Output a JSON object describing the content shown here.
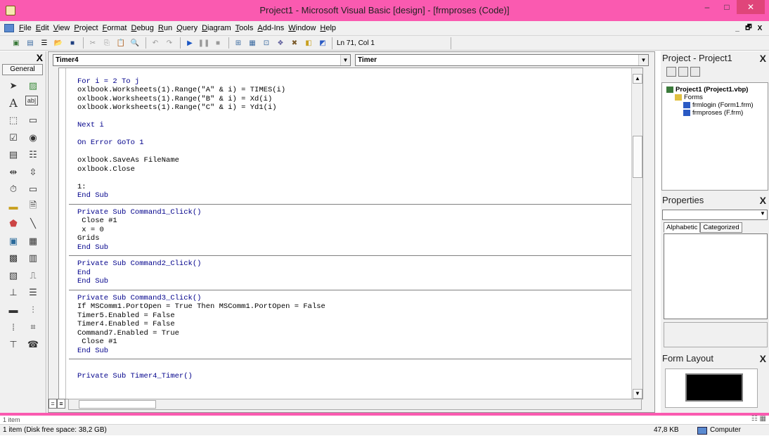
{
  "window": {
    "title": "Project1 - Microsoft Visual Basic [design] - [frmproses (Code)]",
    "minimize": "–",
    "maximize": "□",
    "close": "✕"
  },
  "menu": [
    "File",
    "Edit",
    "View",
    "Project",
    "Format",
    "Debug",
    "Run",
    "Query",
    "Diagram",
    "Tools",
    "Add-Ins",
    "Window",
    "Help"
  ],
  "mdi_controls": [
    "_",
    "🗗",
    "X"
  ],
  "toolbar": {
    "position": "Ln 71, Col 1"
  },
  "toolbox": {
    "close": "X",
    "tab": "General"
  },
  "code": {
    "object_combo": "Timer4",
    "proc_combo": "Timer",
    "lines": [
      {
        "t": "",
        "k": "gap"
      },
      {
        "t": "For i = 2 To j",
        "k": "kw"
      },
      {
        "t": "oxlbook.Worksheets(1).Range(\"A\" & i) = TIMES(i)",
        "k": ""
      },
      {
        "t": "oxlbook.Worksheets(1).Range(\"B\" & i) = Xd(i)",
        "k": ""
      },
      {
        "t": "oxlbook.Worksheets(1).Range(\"C\" & i) = Yd1(i)",
        "k": ""
      },
      {
        "t": "",
        "k": "gap"
      },
      {
        "t": "Next i",
        "k": "kw"
      },
      {
        "t": "",
        "k": "gap"
      },
      {
        "t": "On Error GoTo 1",
        "k": "kw"
      },
      {
        "t": "",
        "k": "gap"
      },
      {
        "t": "oxlbook.SaveAs FileName",
        "k": ""
      },
      {
        "t": "oxlbook.Close",
        "k": ""
      },
      {
        "t": "",
        "k": "gap"
      },
      {
        "t": "1:",
        "k": ""
      },
      {
        "t": "End Sub",
        "k": "kw"
      },
      {
        "t": "",
        "k": "sep"
      },
      {
        "t": "Private Sub Command1_Click()",
        "k": "kw"
      },
      {
        "t": " Close #1",
        "k": ""
      },
      {
        "t": " x = 0",
        "k": ""
      },
      {
        "t": "Grids",
        "k": ""
      },
      {
        "t": "End Sub",
        "k": "kw"
      },
      {
        "t": "",
        "k": "sep"
      },
      {
        "t": "Private Sub Command2_Click()",
        "k": "kw"
      },
      {
        "t": "End",
        "k": "kw"
      },
      {
        "t": "End Sub",
        "k": "kw"
      },
      {
        "t": "",
        "k": "sep"
      },
      {
        "t": "Private Sub Command3_Click()",
        "k": "kw"
      },
      {
        "t": "If MSComm1.PortOpen = True Then MSComm1.PortOpen = False",
        "k": ""
      },
      {
        "t": "Timer5.Enabled = False",
        "k": ""
      },
      {
        "t": "Timer4.Enabled = False",
        "k": ""
      },
      {
        "t": "Command7.Enabled = True",
        "k": ""
      },
      {
        "t": " Close #1",
        "k": ""
      },
      {
        "t": "End Sub",
        "k": "kw"
      },
      {
        "t": "",
        "k": "sep"
      },
      {
        "t": "",
        "k": "gap"
      },
      {
        "t": "Private Sub Timer4_Timer()",
        "k": "kw"
      }
    ]
  },
  "project": {
    "title": "Project - Project1",
    "close": "X",
    "tree": [
      {
        "label": "Project1 (Project1.vbp)",
        "level": 0
      },
      {
        "label": "Forms",
        "level": 1
      },
      {
        "label": "frmlogin (Form1.frm)",
        "level": 2
      },
      {
        "label": "frmproses (F.frm)",
        "level": 2
      }
    ]
  },
  "properties": {
    "title": "Properties",
    "close": "X",
    "tabs": [
      "Alphabetic",
      "Categorized"
    ]
  },
  "form_layout": {
    "title": "Form Layout",
    "close": "X"
  },
  "status": {
    "item_count": "1 item",
    "details": "1 item (Disk free space: 38,2 GB)",
    "size": "47,8 KB",
    "location": "Computer"
  },
  "colors": {
    "titlebar": "#fa5ab0",
    "keyword": "#00008b"
  }
}
